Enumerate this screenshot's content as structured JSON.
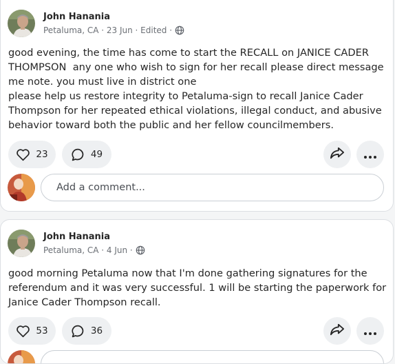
{
  "posts": [
    {
      "author": "John Hanania",
      "meta": "Petaluma, CA · 23 Jun · Edited ·",
      "body": "good evening, the time has come to start the RECALL on JANICE CADER\nTHOMPSON  any one who wish to sign for her recall please direct message\nme note. you must live in district one\nplease help us restore integrity to Petaluma-sign to recall Janice Cader\nThompson for her repeated ethical violations, illegal conduct, and abusive\nbehavior toward both the public and her fellow councilmembers.",
      "likes": "23",
      "comments": "49"
    },
    {
      "author": "John Hanania",
      "meta": "Petaluma, CA · 4 Jun ·",
      "body": "good morning Petaluma now that I'm done gathering signatures for the\nreferendum and it was very successful. 1 will be starting the paperwork for\nJanice Cader Thompson recall.",
      "likes": "53",
      "comments": "36"
    }
  ],
  "comment_input": {
    "placeholder": "Add a comment..."
  },
  "icons": {
    "like": "heart-icon",
    "comment": "speech-bubble-icon",
    "share": "share-arrow-icon",
    "more": "more-dots-icon",
    "visibility": "globe-icon"
  }
}
